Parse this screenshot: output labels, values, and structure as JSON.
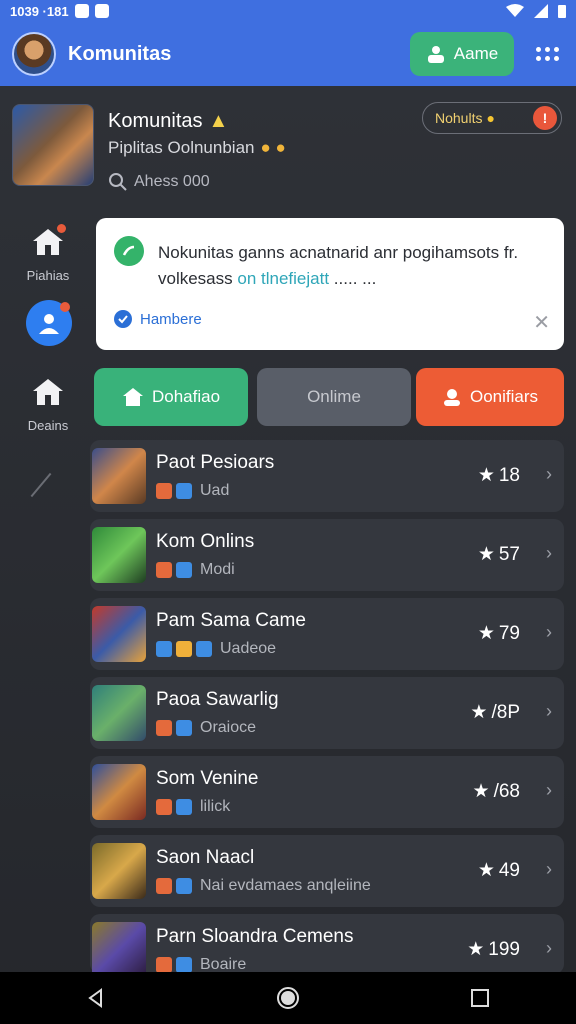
{
  "status_bar": {
    "time": "1039 ·181"
  },
  "app_bar": {
    "title": "Komunitas",
    "action_label": "Aame"
  },
  "profile": {
    "name": "Komunitas",
    "description": "Piplitas Oolnunbian",
    "search_placeholder": "Ahess 000",
    "notif_label": "Nohults"
  },
  "sidebar": {
    "items": [
      {
        "label": "Piahias",
        "icon": "home-icon"
      },
      {
        "label": "Deains",
        "icon": "house-icon"
      }
    ]
  },
  "card": {
    "message_main": "Nokunitas ganns acnatnarid anr pogihamsots fr. volkesass ",
    "message_link": "on tlnefiejatt",
    "message_tail": "..... ...",
    "verified_label": "Hambere"
  },
  "filters": [
    {
      "label": "Dohafiao",
      "color": "#39b27a"
    },
    {
      "label": "Onlime",
      "color": "#595e68"
    },
    {
      "label": "Oonifiars",
      "color": "#ed5c35"
    }
  ],
  "games": [
    {
      "name": "Paot Pesioars",
      "tag": "Uad",
      "score": "18",
      "icons": 2
    },
    {
      "name": "Kom Onlins",
      "tag": "Modi",
      "score": "57",
      "icons": 2
    },
    {
      "name": "Pam Sama Came",
      "tag": "Uadeoe",
      "score": "79",
      "icons": 3
    },
    {
      "name": "Paoa Sawarlig",
      "tag": "Oraioce",
      "score": "/8P",
      "icons": 2
    },
    {
      "name": "Som Venine",
      "tag": "lilick",
      "score": "/68",
      "icons": 2
    },
    {
      "name": "Saon Naacl",
      "tag": "Nai evdamaes anqleiine",
      "score": "49",
      "icons": 2
    },
    {
      "name": "Parn Sloandra Cemens",
      "tag": "Boaire",
      "score": "199",
      "icons": 2
    }
  ]
}
